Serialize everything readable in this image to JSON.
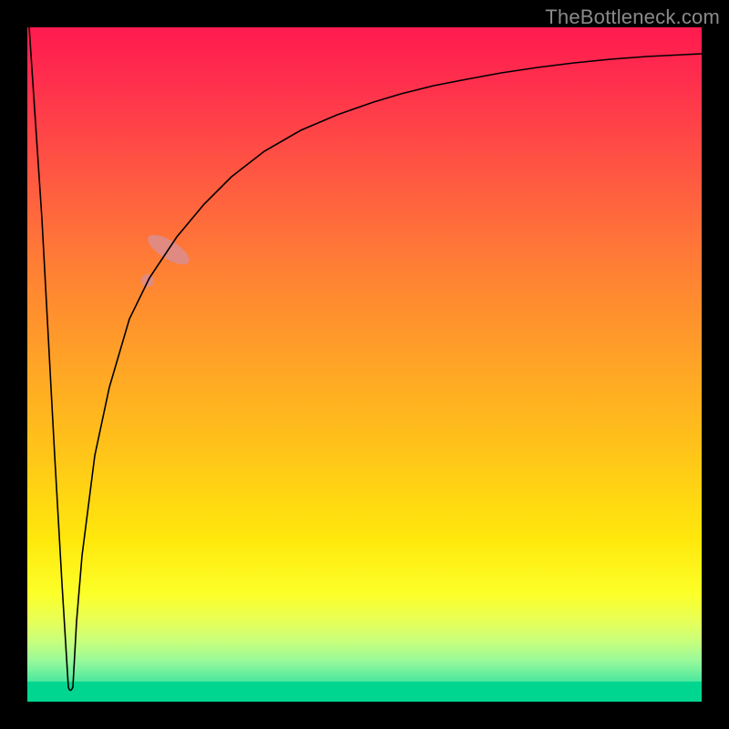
{
  "watermark": "TheBottleneck.com",
  "colors": {
    "frame": "#000000",
    "gradient_top": "#ff1a4f",
    "gradient_bottom": "#00d68f",
    "curve": "#000000",
    "highlight": "#e08a82"
  },
  "chart_data": {
    "type": "line",
    "title": "",
    "xlabel": "",
    "ylabel": "",
    "xlim": [
      0,
      100
    ],
    "ylim": [
      0,
      100
    ],
    "notes": "No axis ticks or numeric labels are rendered. x and y are plot-area percentages (0=left/bottom, 100=right/top). Curve drops from top-left to a minimum near x≈6 at y≈2, then rises asymptotically toward y≈96 at the right edge. A pink highlight segment lies on the rising branch around x≈18–24.",
    "series": [
      {
        "name": "bottleneck-curve",
        "x": [
          0,
          2,
          4,
          5,
          6,
          7,
          8,
          10,
          12,
          15,
          18,
          22,
          26,
          30,
          35,
          40,
          45,
          50,
          55,
          60,
          65,
          70,
          75,
          80,
          85,
          90,
          95,
          100
        ],
        "y": [
          100,
          70,
          35,
          15,
          2,
          12,
          22,
          37,
          47,
          57,
          63,
          69,
          74,
          78,
          82,
          85,
          87,
          89,
          90.5,
          91.8,
          92.8,
          93.6,
          94.2,
          94.8,
          95.2,
          95.6,
          95.9,
          96.1
        ]
      }
    ],
    "highlight": {
      "name": "pink-segment",
      "x_range": [
        18,
        24
      ],
      "approx_y_range": [
        63,
        71
      ]
    }
  }
}
